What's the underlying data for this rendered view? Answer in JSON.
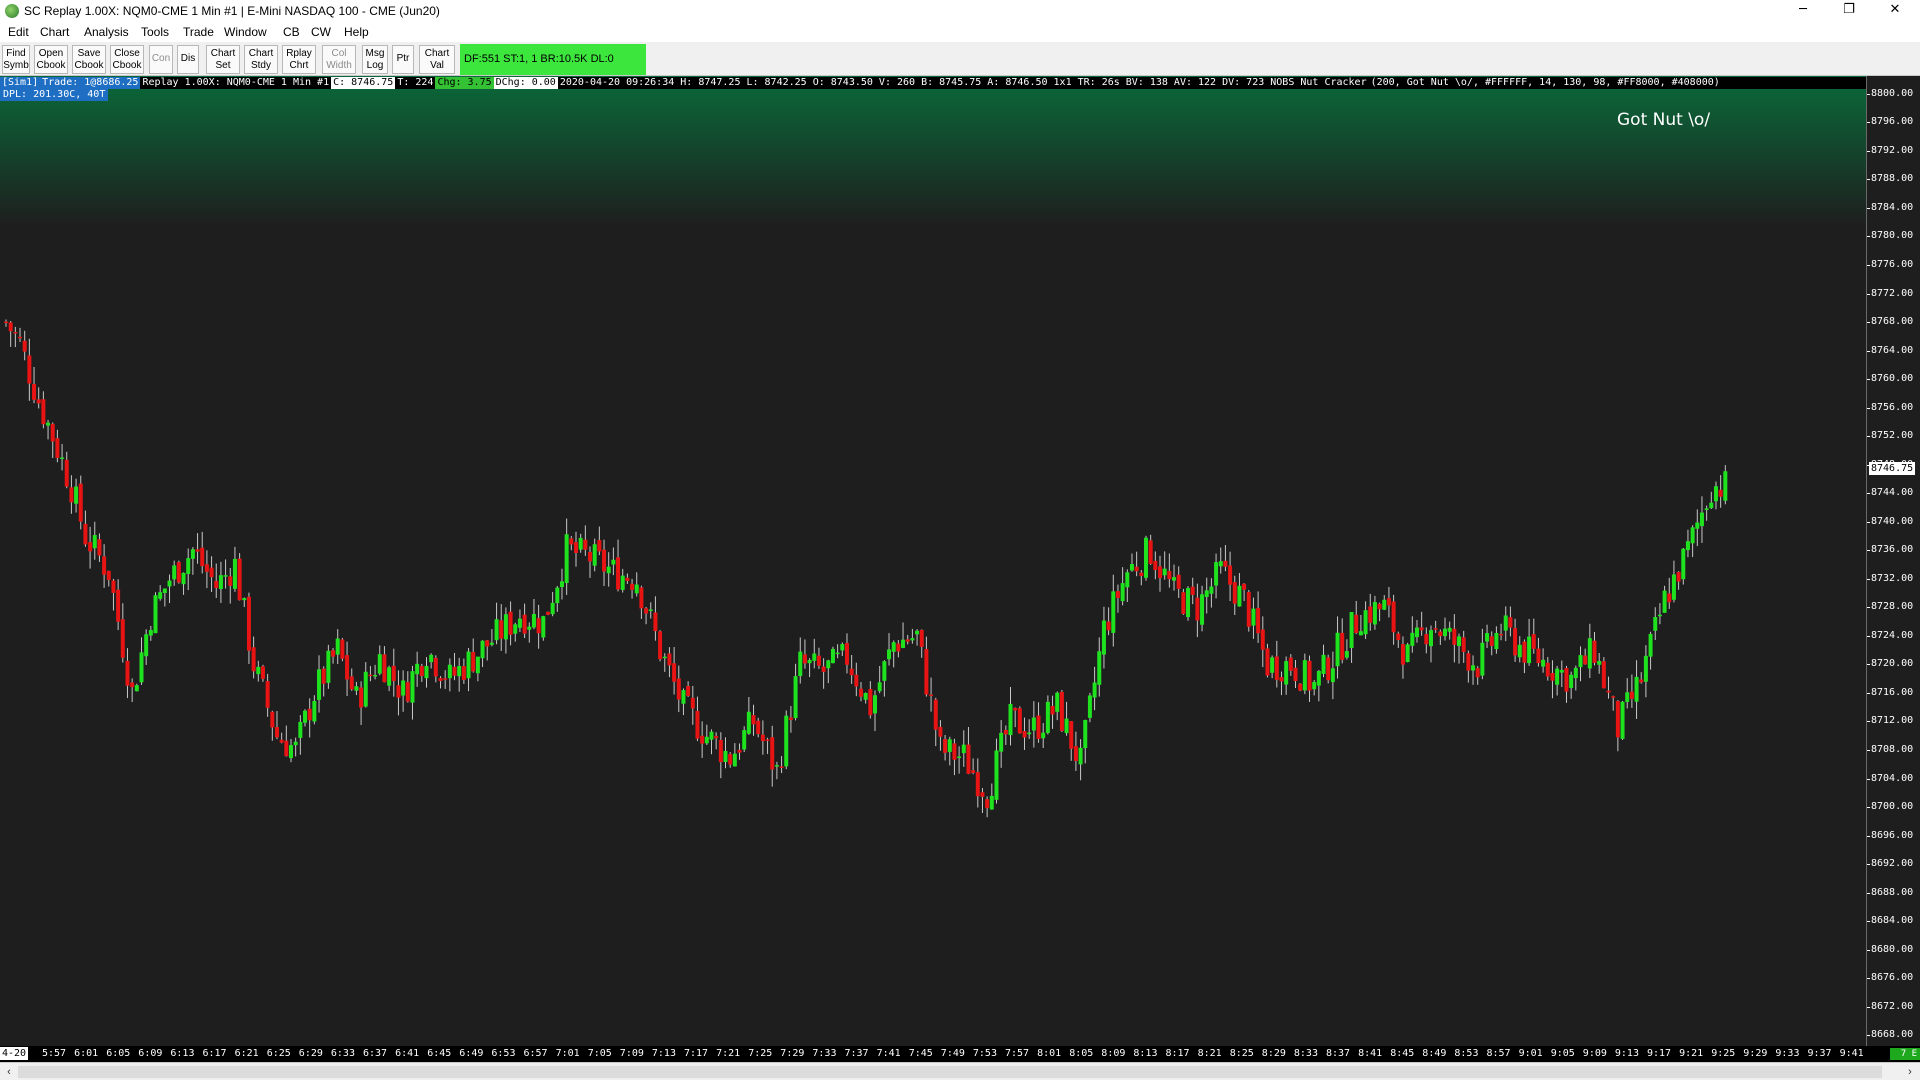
{
  "window": {
    "title": "SC Replay 1.00X: NQM0-CME  1 Min  #1 | E-Mini NASDAQ 100 - CME (Jun20)",
    "minimize": "─",
    "restore": "❐",
    "close": "✕"
  },
  "menu": [
    "Edit",
    "Chart",
    "Analysis",
    "Tools",
    "Trade",
    "Window",
    "CB",
    "CW",
    "Help"
  ],
  "toolbar": {
    "buttons": [
      {
        "line1": "Find",
        "line2": "Symb"
      },
      {
        "line1": "Open",
        "line2": "Cbook"
      },
      {
        "line1": "Save",
        "line2": "Cbook"
      },
      {
        "line1": "Close",
        "line2": "Cbook"
      },
      {
        "line1": "Con",
        "line2": ""
      },
      {
        "line1": "Dis",
        "line2": ""
      },
      {
        "line1": "Chart",
        "line2": "Set"
      },
      {
        "line1": "Chart",
        "line2": "Stdy"
      },
      {
        "line1": "Rplay",
        "line2": "Chrt"
      },
      {
        "line1": "Col",
        "line2": "Width"
      },
      {
        "line1": "Msg",
        "line2": "Log"
      },
      {
        "line1": "Ptr",
        "line2": ""
      },
      {
        "line1": "Chart",
        "line2": "Val"
      }
    ],
    "status": "DF:551  ST:1, 1  BR:10.5K  DL:0"
  },
  "infobar": {
    "sim": "[Sim1]",
    "trade": "Trade: 1@8686.25",
    "replay": "Replay 1.00X: NQM0-CME  1 Min  #1",
    "close": "C: 8746.75",
    "trades": "T: 224",
    "chg": "Chg: 3.75",
    "dchg": "DChg: 0.00",
    "details": "2020-04-20 09:26:34 H: 8747.25 L: 8742.25 O: 8743.50 V: 260 B: 8745.75 A: 8746.50 1x1 TR: 26s BV: 138 AV: 122 DV: 723 NOBS Nut Cracker",
    "params": "(200, Got Nut \\o/, #FFFFFF, 14, 130, 98, #FF8000, #408000)"
  },
  "dpl": "DPL: 201.30C, 40T",
  "annotation": "Got Nut \\o/",
  "last_price": "8746.75",
  "date_label": "4-20",
  "corner_badge": "7 E",
  "colors": {
    "up": "#1fe21f",
    "down": "#e81313",
    "wick": "#c8c8c8",
    "background": "#1e1e1e",
    "gradient_top": "#0a6a3a"
  },
  "chart_data": {
    "type": "candlestick",
    "symbol": "NQM0-CME",
    "interval": "1 Min",
    "y_ticks": [
      8800,
      8796,
      8792,
      8788,
      8784,
      8780,
      8776,
      8772,
      8768,
      8764,
      8760,
      8756,
      8752,
      8748,
      8744,
      8740,
      8736,
      8732,
      8728,
      8724,
      8720,
      8716,
      8712,
      8708,
      8704,
      8700,
      8696,
      8692,
      8688,
      8684,
      8680,
      8676,
      8672,
      8668
    ],
    "ylim": [
      8666.5,
      8802.5
    ],
    "x_ticks": [
      "5:57",
      "6:01",
      "6:05",
      "6:09",
      "6:13",
      "6:17",
      "6:21",
      "6:25",
      "6:29",
      "6:33",
      "6:37",
      "6:41",
      "6:45",
      "6:49",
      "6:53",
      "6:57",
      "7:01",
      "7:05",
      "7:09",
      "7:13",
      "7:17",
      "7:21",
      "7:25",
      "7:29",
      "7:33",
      "7:37",
      "7:41",
      "7:45",
      "7:49",
      "7:53",
      "7:57",
      "8:01",
      "8:05",
      "8:09",
      "8:13",
      "8:17",
      "8:21",
      "8:25",
      "8:29",
      "8:33",
      "8:37",
      "8:41",
      "8:45",
      "8:49",
      "8:53",
      "8:57",
      "9:01",
      "9:05",
      "9:09",
      "9:13",
      "9:17",
      "9:21",
      "9:25",
      "9:29",
      "9:33",
      "9:37",
      "9:41"
    ],
    "close_path": [
      [
        0,
        8768
      ],
      [
        3,
        8765
      ],
      [
        7,
        8757
      ],
      [
        10,
        8752
      ],
      [
        14,
        8745
      ],
      [
        17,
        8738
      ],
      [
        22,
        8733
      ],
      [
        27,
        8716
      ],
      [
        31,
        8727
      ],
      [
        35,
        8732
      ],
      [
        40,
        8736
      ],
      [
        45,
        8731
      ],
      [
        49,
        8734
      ],
      [
        53,
        8720
      ],
      [
        58,
        8710
      ],
      [
        62,
        8708
      ],
      [
        66,
        8716
      ],
      [
        71,
        8722
      ],
      [
        75,
        8715
      ],
      [
        80,
        8721
      ],
      [
        85,
        8716
      ],
      [
        90,
        8722
      ],
      [
        95,
        8718
      ],
      [
        100,
        8721
      ],
      [
        105,
        8724
      ],
      [
        110,
        8727
      ],
      [
        115,
        8726
      ],
      [
        120,
        8736
      ],
      [
        125,
        8735
      ],
      [
        130,
        8733
      ],
      [
        135,
        8732
      ],
      [
        140,
        8722
      ],
      [
        145,
        8714
      ],
      [
        150,
        8710
      ],
      [
        155,
        8707
      ],
      [
        160,
        8712
      ],
      [
        165,
        8705
      ],
      [
        170,
        8720
      ],
      [
        175,
        8719
      ],
      [
        180,
        8721
      ],
      [
        185,
        8714
      ],
      [
        190,
        8723
      ],
      [
        195,
        8724
      ],
      [
        200,
        8708
      ],
      [
        205,
        8707
      ],
      [
        210,
        8702
      ],
      [
        215,
        8712
      ],
      [
        220,
        8711
      ],
      [
        225,
        8714
      ],
      [
        230,
        8706
      ],
      [
        235,
        8725
      ],
      [
        240,
        8733
      ],
      [
        245,
        8736
      ],
      [
        250,
        8730
      ],
      [
        255,
        8728
      ],
      [
        260,
        8733
      ],
      [
        265,
        8729
      ],
      [
        270,
        8720
      ],
      [
        275,
        8720
      ],
      [
        280,
        8717
      ],
      [
        285,
        8722
      ],
      [
        290,
        8727
      ],
      [
        295,
        8728
      ],
      [
        300,
        8721
      ],
      [
        305,
        8726
      ],
      [
        310,
        8723
      ],
      [
        315,
        8720
      ],
      [
        320,
        8725
      ],
      [
        325,
        8722
      ],
      [
        330,
        8720
      ],
      [
        335,
        8718
      ],
      [
        340,
        8722
      ],
      [
        345,
        8711
      ],
      [
        350,
        8718
      ],
      [
        355,
        8729
      ],
      [
        360,
        8736
      ],
      [
        365,
        8745
      ]
    ],
    "candle_count": 369
  }
}
